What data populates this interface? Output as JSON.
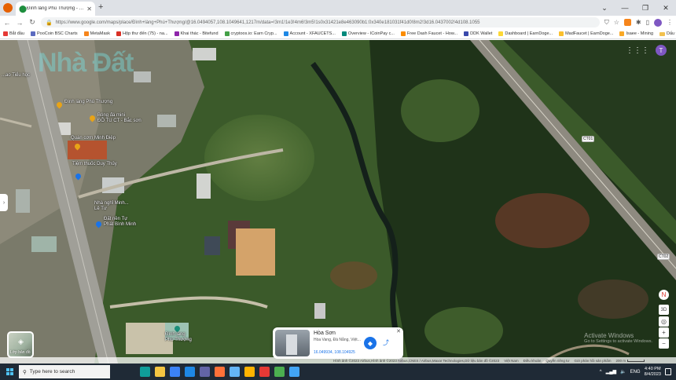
{
  "browser": {
    "tab_title": "Đình làng Phú Thượng - Google",
    "url": "https://www.google.com/maps/place/Đình+làng+Phú+Thượng/@16.0494057,108.1049641,1217m/data=!3m1!1e3!4m6!3m5!1s0x31421e8e463090b1:0x340e181031f41d0!8m2!3d16.0437002!4d108.1055"
  },
  "bookmarks": [
    {
      "label": "Bắt đầu",
      "color": "#e53935"
    },
    {
      "label": "PooCoin BSC Charts",
      "color": "#5c6bc0"
    },
    {
      "label": "MetaMask",
      "color": "#f6851b"
    },
    {
      "label": "Hộp thư đến (75) - na...",
      "color": "#d93025"
    },
    {
      "label": "Khai thác - Bitefund",
      "color": "#8e24aa"
    },
    {
      "label": "cryptoos.io: Earn Cryp...",
      "color": "#43a047"
    },
    {
      "label": "Account - XFAUCETS...",
      "color": "#1e88e5"
    },
    {
      "label": "Overview - ICoinPay c...",
      "color": "#00897b"
    },
    {
      "label": "Free Dash Faucet - How...",
      "color": "#fb8c00"
    },
    {
      "label": "DDK Wallet",
      "color": "#3949ab"
    },
    {
      "label": "Dashboard | EarnDoge...",
      "color": "#fdd835"
    },
    {
      "label": "MadFaucet | EarnDoge...",
      "color": "#fbc02d"
    },
    {
      "label": "Isaee - Mining",
      "color": "#f9a825"
    }
  ],
  "bookmarks_folder": "Dấu trang khác",
  "map": {
    "watermark": "Nhà Đất",
    "user_initial": "T",
    "poi_labels": [
      {
        "text": "...ao Tiểu học",
        "pin": "none"
      },
      {
        "text": "Đình làng Phú Thượng",
        "pin": "#e8a317"
      },
      {
        "text": "Bóng đá mini\nĐỒ TU CT - Bắc sơn",
        "pin": "#e8a317"
      },
      {
        "text": "Quán cơm Minh Điệp",
        "pin": "#e8a317"
      },
      {
        "text": "Tiệm thuốc Duy Thủy",
        "pin": "#1a73e8"
      },
      {
        "text": "Nhà nghỉ Minh...\nLê Tư",
        "pin": "none"
      },
      {
        "text": "Đất nền Tự\nPhát Bình Minh",
        "pin": "#1a73e8"
      },
      {
        "text": "Đình làng\nPhú Thượng",
        "pin": "#1a8f7a"
      }
    ],
    "road_labels": [
      "CT01",
      "CT02"
    ],
    "layers_label": "Lớp bản đồ",
    "info_card": {
      "name": "Hòa Sơn",
      "address": "Hòa Vang, Đà Nẵng, Việt...",
      "coords": "16.049934, 108.104925"
    },
    "controls": {
      "compass": "N",
      "view_3d": "3D",
      "zoom_in": "+",
      "zoom_out": "−"
    },
    "activate": {
      "title": "Activate Windows",
      "subtitle": "Go to Settings to activate Windows."
    },
    "attribution": {
      "imagery": "Hình ảnh ©2023 Airbus,Hình ảnh ©2023 Airbus,CNES / Airbus,Maxar Technologies,Dữ liệu bản đồ ©2023",
      "links": [
        "Việt Nam",
        "Điều khoản",
        "Quyền riêng tư",
        "Gửi phản hồi sản phẩm"
      ],
      "scale": "200 m"
    }
  },
  "taskbar": {
    "search_placeholder": "Type here to search",
    "apps": [
      {
        "name": "edge",
        "color": "#0f9d9a"
      },
      {
        "name": "file-explorer",
        "color": "#f4c542"
      },
      {
        "name": "store",
        "color": "#3b82f6"
      },
      {
        "name": "mail",
        "color": "#1e88e5"
      },
      {
        "name": "teams",
        "color": "#6264a7"
      },
      {
        "name": "firefox",
        "color": "#ff7139"
      },
      {
        "name": "app-7",
        "color": "#64b5f6"
      },
      {
        "name": "app-8",
        "color": "#ffb300"
      },
      {
        "name": "app-9",
        "color": "#e53935"
      },
      {
        "name": "app-10",
        "color": "#4caf50"
      },
      {
        "name": "app-11",
        "color": "#42a5f5"
      }
    ],
    "language": "ENG",
    "time": "4:40 PM",
    "date": "8/4/2023"
  }
}
